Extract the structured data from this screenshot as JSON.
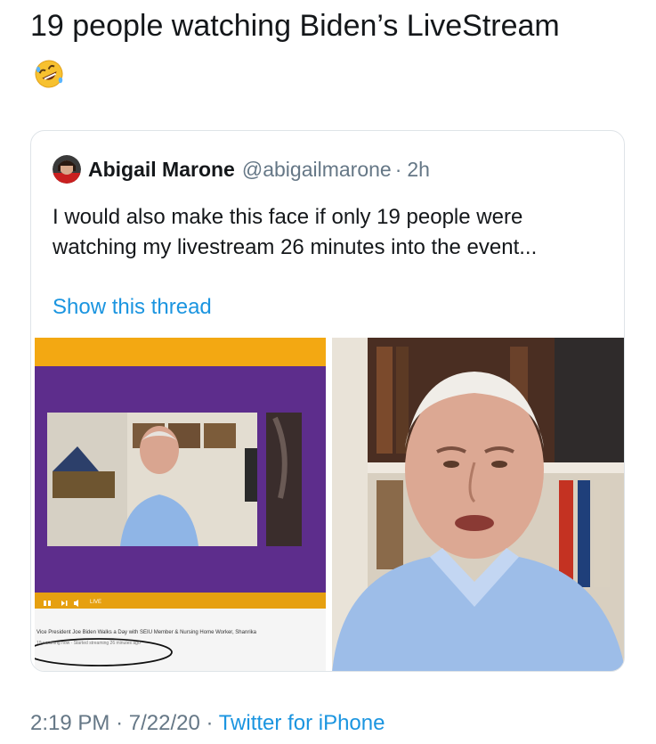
{
  "tweet": {
    "text": "19 people watching Biden’s LiveStream",
    "emoji": "rolling-on-floor-laughing"
  },
  "quoted_tweet": {
    "author_name": "Abigail Marone",
    "handle": "@abigailmarone",
    "separator": "·",
    "time_ago": "2h",
    "body": "I would also make this face if only 19 people were watching my livestream 26 minutes into the event...",
    "show_thread": "Show this thread",
    "media": {
      "left_video": {
        "controls_live": "LIVE",
        "caption": "Vice President Joe Biden Walks a Day with SEIU Member & Nursing Home Worker, Shanrika",
        "meta": "19 watching now · Started streaming 26 minutes ago"
      }
    }
  },
  "footer": {
    "time": "2:19 PM",
    "sep1": "·",
    "date": "7/22/20",
    "sep2": "·",
    "source": "Twitter for iPhone"
  },
  "colors": {
    "link": "#1b95e0",
    "muted": "#657786",
    "video_frame": "#5d2d8c",
    "video_bar": "#f3a812"
  }
}
